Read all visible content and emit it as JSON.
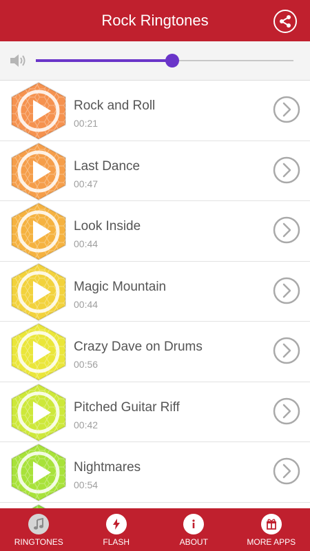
{
  "header": {
    "title": "Rock Ringtones",
    "share_icon": "share-icon"
  },
  "volume": {
    "icon": "speaker-icon",
    "level": 0.53,
    "accent": "#6a35c9"
  },
  "ringtones": [
    {
      "name": "Rock and Roll",
      "duration": "00:21",
      "color": "#f5924f"
    },
    {
      "name": "Last Dance",
      "duration": "00:47",
      "color": "#f59e4a"
    },
    {
      "name": "Look Inside",
      "duration": "00:44",
      "color": "#f5b240"
    },
    {
      "name": "Magic Mountain",
      "duration": "00:44",
      "color": "#f2d23c"
    },
    {
      "name": "Crazy Dave on Drums",
      "duration": "00:56",
      "color": "#eae63a"
    },
    {
      "name": "Pitched Guitar Riff",
      "duration": "00:42",
      "color": "#cde83a"
    },
    {
      "name": "Nightmares",
      "duration": "00:54",
      "color": "#a8e23a"
    },
    {
      "name": "",
      "duration": "",
      "color": "#8edb3a"
    }
  ],
  "bottom_nav": [
    {
      "label": "RINGTONES",
      "icon": "music-note-icon"
    },
    {
      "label": "FLASH",
      "icon": "lightning-icon"
    },
    {
      "label": "ABOUT",
      "icon": "info-icon"
    },
    {
      "label": "MORE APPS",
      "icon": "gift-icon"
    }
  ],
  "colors": {
    "primary": "#c0202e",
    "accent": "#6a35c9"
  }
}
